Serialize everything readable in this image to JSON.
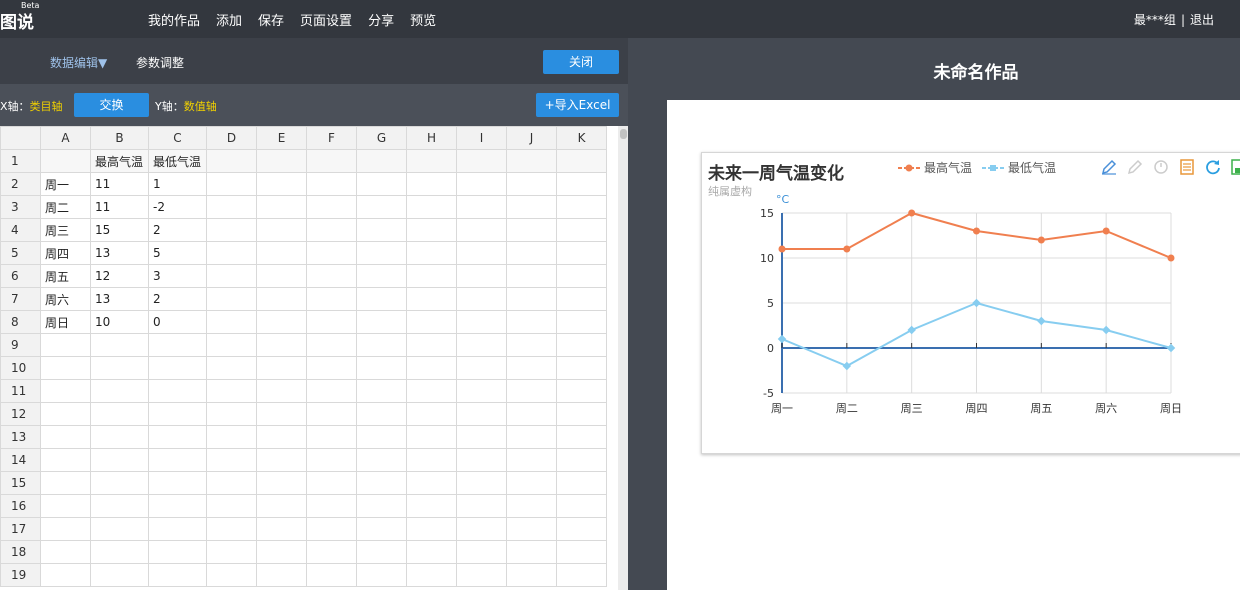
{
  "app": {
    "logo": "图说",
    "beta": "Beta"
  },
  "nav": [
    "我的作品",
    "添加",
    "保存",
    "页面设置",
    "分享",
    "预览"
  ],
  "user": {
    "name": "最***组",
    "sep": "|",
    "logout": "退出"
  },
  "editor": {
    "mode_edit": "数据编辑▼",
    "mode_param": "参数调整",
    "close": "关闭",
    "x_axis_label": "X轴：",
    "x_axis_value": "类目轴",
    "swap": "交换",
    "y_axis_label": "Y轴：",
    "y_axis_value": "数值轴",
    "import": "+导入Excel"
  },
  "sheet": {
    "columns": [
      "A",
      "B",
      "C",
      "D",
      "E",
      "F",
      "G",
      "H",
      "I",
      "J",
      "K"
    ],
    "rows": [
      [
        "",
        "最高气温",
        "最低气温",
        "",
        "",
        "",
        "",
        "",
        "",
        "",
        ""
      ],
      [
        "周一",
        "11",
        "1",
        "",
        "",
        "",
        "",
        "",
        "",
        "",
        ""
      ],
      [
        "周二",
        "11",
        "-2",
        "",
        "",
        "",
        "",
        "",
        "",
        "",
        ""
      ],
      [
        "周三",
        "15",
        "2",
        "",
        "",
        "",
        "",
        "",
        "",
        "",
        ""
      ],
      [
        "周四",
        "13",
        "5",
        "",
        "",
        "",
        "",
        "",
        "",
        "",
        ""
      ],
      [
        "周五",
        "12",
        "3",
        "",
        "",
        "",
        "",
        "",
        "",
        "",
        ""
      ],
      [
        "周六",
        "13",
        "2",
        "",
        "",
        "",
        "",
        "",
        "",
        "",
        ""
      ],
      [
        "周日",
        "10",
        "0",
        "",
        "",
        "",
        "",
        "",
        "",
        "",
        ""
      ],
      [
        "",
        "",
        "",
        "",
        "",
        "",
        "",
        "",
        "",
        "",
        ""
      ],
      [
        "",
        "",
        "",
        "",
        "",
        "",
        "",
        "",
        "",
        "",
        ""
      ],
      [
        "",
        "",
        "",
        "",
        "",
        "",
        "",
        "",
        "",
        "",
        ""
      ],
      [
        "",
        "",
        "",
        "",
        "",
        "",
        "",
        "",
        "",
        "",
        ""
      ],
      [
        "",
        "",
        "",
        "",
        "",
        "",
        "",
        "",
        "",
        "",
        ""
      ],
      [
        "",
        "",
        "",
        "",
        "",
        "",
        "",
        "",
        "",
        "",
        ""
      ],
      [
        "",
        "",
        "",
        "",
        "",
        "",
        "",
        "",
        "",
        "",
        ""
      ],
      [
        "",
        "",
        "",
        "",
        "",
        "",
        "",
        "",
        "",
        "",
        ""
      ],
      [
        "",
        "",
        "",
        "",
        "",
        "",
        "",
        "",
        "",
        "",
        ""
      ],
      [
        "",
        "",
        "",
        "",
        "",
        "",
        "",
        "",
        "",
        "",
        ""
      ],
      [
        "",
        "",
        "",
        "",
        "",
        "",
        "",
        "",
        "",
        "",
        ""
      ]
    ]
  },
  "work_title": "未命名作品",
  "chart_data": {
    "type": "line",
    "title": "未来一周气温变化",
    "subtitle": "纯属虚构",
    "ylabel": "°C",
    "categories": [
      "周一",
      "周二",
      "周三",
      "周四",
      "周五",
      "周六",
      "周日"
    ],
    "series": [
      {
        "name": "最高气温",
        "values": [
          11,
          11,
          15,
          13,
          12,
          13,
          10
        ],
        "color": "#f07f4f"
      },
      {
        "name": "最低气温",
        "values": [
          1,
          -2,
          2,
          5,
          3,
          2,
          0
        ],
        "color": "#87cdf0"
      }
    ],
    "ylim": [
      -5,
      15
    ],
    "yticks": [
      15,
      10,
      5,
      0,
      -5
    ],
    "grid": true,
    "legend_position": "top"
  },
  "toolbox_icons": [
    "edit-icon",
    "pen-icon",
    "stamp-icon",
    "data-view-icon",
    "refresh-icon",
    "save-icon"
  ],
  "colors": {
    "accent": "#2a8ee0",
    "axis_type": "#f0d000",
    "high": "#f07f4f",
    "low": "#87cdf0"
  }
}
